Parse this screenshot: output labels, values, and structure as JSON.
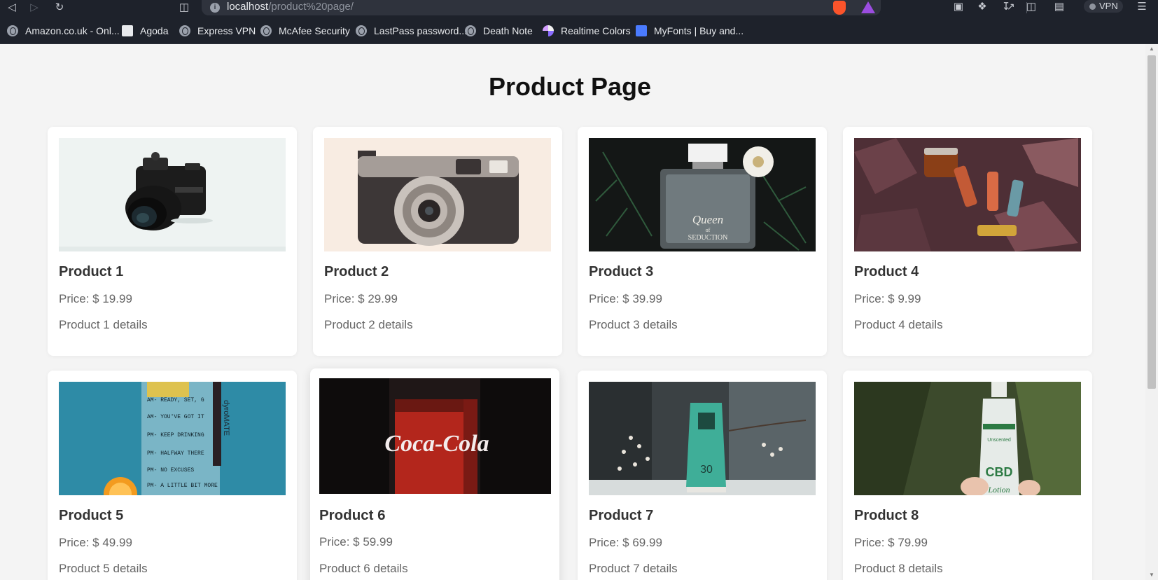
{
  "browser": {
    "url_host": "localhost",
    "url_path": "/product%20page/",
    "vpn_label": "VPN",
    "bookmarks": [
      {
        "label": "Amazon.co.uk - Onl...",
        "icon": "globe-icon"
      },
      {
        "label": "Agoda",
        "icon": "agoda-icon"
      },
      {
        "label": "Express VPN",
        "icon": "globe-icon"
      },
      {
        "label": "McAfee Security",
        "icon": "globe-icon"
      },
      {
        "label": "LastPass password...",
        "icon": "globe-icon"
      },
      {
        "label": "Death Note",
        "icon": "globe-icon"
      },
      {
        "label": "Realtime Colors",
        "icon": "realtime-colors-icon"
      },
      {
        "label": "MyFonts | Buy and...",
        "icon": "myfonts-icon"
      }
    ]
  },
  "page": {
    "title": "Product Page",
    "products": [
      {
        "name": "Product 1",
        "price": "Price: $ 19.99",
        "details": "Product 1 details",
        "image": "black mirrorless camera"
      },
      {
        "name": "Product 2",
        "price": "Price: $ 29.99",
        "details": "Product 2 details",
        "image": "vintage film camera"
      },
      {
        "name": "Product 3",
        "price": "Price: $ 39.99",
        "details": "Product 3 details",
        "image": "perfume bottle"
      },
      {
        "name": "Product 4",
        "price": "Price: $ 9.99",
        "details": "Product 4 details",
        "image": "cosmetics on autumn leaves"
      },
      {
        "name": "Product 5",
        "price": "Price: $ 49.99",
        "details": "Product 5 details",
        "image": "motivational water bottle"
      },
      {
        "name": "Product 6",
        "price": "Price: $ 59.99",
        "details": "Product 6 details",
        "image": "cola bottle"
      },
      {
        "name": "Product 7",
        "price": "Price: $ 69.99",
        "details": "Product 7 details",
        "image": "green cream tube"
      },
      {
        "name": "Product 8",
        "price": "Price: $ 79.99",
        "details": "Product 8 details",
        "image": "lotion bottle"
      }
    ],
    "image_texts": {
      "perfume_label": "Queen",
      "perfume_sub": "of",
      "perfume_sub2": "SEDUCTION",
      "bottle_brand": "dyroMATE",
      "bottle_lines": [
        "AM- READY, SET, G",
        "AM- YOU'VE GOT IT",
        "PM- KEEP DRINKING",
        "PM- HALFWAY THERE",
        "PM- NO EXCUSES",
        "PM- A LITTLE BIT MORE"
      ],
      "cola_logo": "Coca-Cola",
      "tube_number": "30",
      "lotion_top": "Unscented",
      "lotion_mid": "CBD",
      "lotion_bottom": "Lotion"
    }
  }
}
